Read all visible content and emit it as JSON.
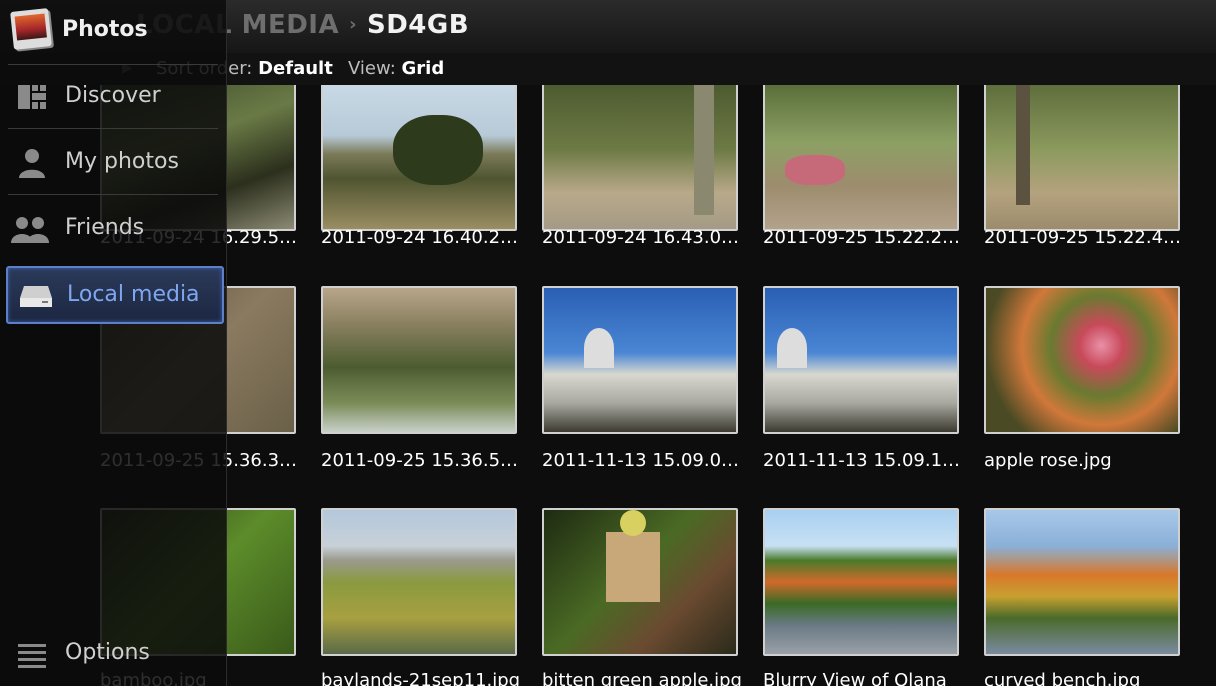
{
  "header": {
    "breadcrumb_parent": "LOCAL MEDIA",
    "breadcrumb_current": "SD4GB",
    "sort_label": "Sort order:",
    "sort_value": "Default",
    "view_label": "View:",
    "view_value": "Grid"
  },
  "drawer": {
    "app_name": "Photos",
    "items": [
      {
        "label": "Discover",
        "icon": "discover-icon"
      },
      {
        "label": "My photos",
        "icon": "person-icon"
      },
      {
        "label": "Friends",
        "icon": "friends-icon"
      },
      {
        "label": "Local media",
        "icon": "storage-icon",
        "active": true
      }
    ],
    "options_label": "Options",
    "accent": "#5d7fc8"
  },
  "photos": [
    {
      "name": "2011-09-24 16.29.53.j..."
    },
    {
      "name": "2011-09-24 16.40.23.j..."
    },
    {
      "name": "2011-09-24 16.43.01.j..."
    },
    {
      "name": "2011-09-25 15.22.27.j..."
    },
    {
      "name": "2011-09-25 15.22.41.j..."
    },
    {
      "name": "2011-09-25 15.36.38.j..."
    },
    {
      "name": "2011-09-25 15.36.58.j..."
    },
    {
      "name": "2011-11-13 15.09.06.j..."
    },
    {
      "name": "2011-11-13 15.09.17.j..."
    },
    {
      "name": "apple rose.jpg"
    },
    {
      "name": "bamboo.jpg"
    },
    {
      "name": "baylands-21sep11.jpg"
    },
    {
      "name": "bitten green apple.jpg"
    },
    {
      "name": "Blurry View of Olana"
    },
    {
      "name": "curved bench.jpg"
    }
  ]
}
